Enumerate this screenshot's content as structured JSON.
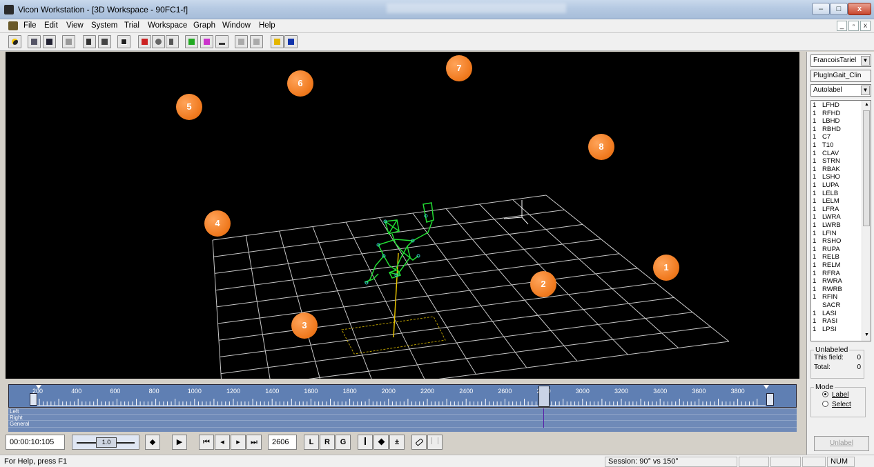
{
  "window": {
    "title": "Vicon Workstation - [3D Workspace - 90FC1-f]",
    "controls": {
      "minimize": "–",
      "maximize": "□",
      "close": "x"
    }
  },
  "menubar": {
    "items": [
      "File",
      "Edit",
      "View",
      "System",
      "Trial",
      "Workspace",
      "Graph",
      "Window",
      "Help"
    ],
    "mdi": {
      "minimize": "_",
      "restore": "▫",
      "close": "x"
    }
  },
  "toolbar": {
    "icons": [
      "record-icon",
      "open-icon",
      "save-icon",
      "print-icon",
      "skeleton-icon",
      "capture-icon",
      "realtime-icon",
      "workstation-icon",
      "cameras-icon",
      "clip-icon",
      "pipeline-icon",
      "graph-icon",
      "ground-icon",
      "undo-icon",
      "redo-icon",
      "help-icon",
      "context-help-icon"
    ]
  },
  "viewport": {
    "markers": [
      "1",
      "2",
      "3",
      "4",
      "5",
      "6",
      "7",
      "8"
    ],
    "colors": {
      "background": "#000000",
      "grid": "#c8c8c8",
      "skeleton": "#22dd33",
      "marker_points": "#33cccc",
      "force_vector": "#e6c200"
    }
  },
  "timeline": {
    "ticks": [
      "200",
      "400",
      "600",
      "800",
      "1000",
      "1200",
      "1400",
      "1600",
      "1800",
      "2000",
      "2200",
      "2400",
      "2600",
      "2800",
      "3000",
      "3200",
      "3400",
      "3600",
      "3800"
    ],
    "tracks": [
      "Left",
      "Right",
      "General"
    ],
    "current_frame_fraction": 0.696
  },
  "playback": {
    "timecode": "00:00:10:105",
    "speed": "1.0",
    "frame": "2606",
    "buttons": {
      "bounce": "◆",
      "play": "▶",
      "first": "⏮",
      "prev": "◂",
      "next": "▸",
      "last": "⏭"
    },
    "toggles": [
      "L",
      "R",
      "G"
    ]
  },
  "right_panel": {
    "subject": "FrancoisTariel",
    "model": "PlugInGait_Clin",
    "mode_select": "Autolabel",
    "markers": [
      {
        "count": "1",
        "name": "LFHD"
      },
      {
        "count": "1",
        "name": "RFHD"
      },
      {
        "count": "1",
        "name": "LBHD"
      },
      {
        "count": "1",
        "name": "RBHD"
      },
      {
        "count": "1",
        "name": "C7"
      },
      {
        "count": "1",
        "name": "T10"
      },
      {
        "count": "1",
        "name": "CLAV"
      },
      {
        "count": "1",
        "name": "STRN"
      },
      {
        "count": "1",
        "name": "RBAK"
      },
      {
        "count": "1",
        "name": "LSHO"
      },
      {
        "count": "1",
        "name": "LUPA"
      },
      {
        "count": "1",
        "name": "LELB"
      },
      {
        "count": "1",
        "name": "LELM"
      },
      {
        "count": "1",
        "name": "LFRA"
      },
      {
        "count": "1",
        "name": "LWRA"
      },
      {
        "count": "1",
        "name": "LWRB"
      },
      {
        "count": "1",
        "name": "LFIN"
      },
      {
        "count": "1",
        "name": "RSHO"
      },
      {
        "count": "1",
        "name": "RUPA"
      },
      {
        "count": "1",
        "name": "RELB"
      },
      {
        "count": "1",
        "name": "RELM"
      },
      {
        "count": "1",
        "name": "RFRA"
      },
      {
        "count": "1",
        "name": "RWRA"
      },
      {
        "count": "1",
        "name": "RWRB"
      },
      {
        "count": "1",
        "name": "RFIN"
      },
      {
        "count": "",
        "name": "SACR"
      },
      {
        "count": "1",
        "name": "LASI"
      },
      {
        "count": "1",
        "name": "RASI"
      },
      {
        "count": "1",
        "name": "LPSI"
      }
    ],
    "unlabeled": {
      "legend": "Unlabeled",
      "this_field_label": "This field:",
      "this_field_value": "0",
      "total_label": "Total:",
      "total_value": "0"
    },
    "mode": {
      "legend": "Mode",
      "options": [
        "Label",
        "Select"
      ],
      "selected": "Label"
    },
    "unlabel_button": "Unlabel"
  },
  "statusbar": {
    "help": "For Help, press F1",
    "session": "Session:  90° vs 150°",
    "num": "NUM"
  }
}
